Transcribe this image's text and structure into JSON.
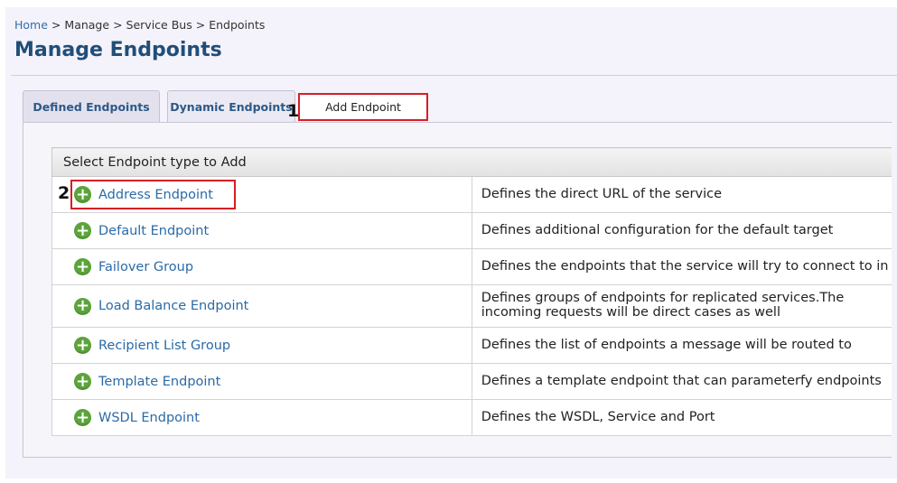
{
  "breadcrumb": {
    "items": [
      "Home",
      "Manage",
      "Service Bus",
      "Endpoints"
    ],
    "separator": ">"
  },
  "page_title": "Manage Endpoints",
  "tabs": {
    "defined": "Defined Endpoints",
    "dynamic": "Dynamic Endpoints",
    "add": "Add Endpoint"
  },
  "callouts": {
    "one": "1",
    "two": "2"
  },
  "table": {
    "header": "Select Endpoint type to Add",
    "rows": [
      {
        "name": "Address Endpoint",
        "icon": "plus-circle-icon",
        "description": "Defines the direct URL of the service"
      },
      {
        "name": "Default Endpoint",
        "icon": "plus-circle-icon",
        "description": "Defines additional configuration for the default target"
      },
      {
        "name": "Failover Group",
        "icon": "plus-circle-icon",
        "description": "Defines the endpoints that the service will try to connect to in case of a failure. This will"
      },
      {
        "name": "Load Balance Endpoint",
        "icon": "plus-circle-icon",
        "description": "Defines groups of endpoints for replicated services.The incoming requests will be direct cases as well"
      },
      {
        "name": "Recipient List Group",
        "icon": "plus-circle-icon",
        "description": "Defines the list of endpoints a message will be routed to"
      },
      {
        "name": "Template Endpoint",
        "icon": "plus-circle-icon",
        "description": "Defines a template endpoint that can parameterfy endpoints"
      },
      {
        "name": "WSDL Endpoint",
        "icon": "plus-circle-icon",
        "description": "Defines the WSDL, Service and Port"
      }
    ]
  },
  "colors": {
    "accent": "#2a6aa7",
    "title": "#1f4e79",
    "highlight": "#d51f26",
    "icon_green": "#5ba43a"
  }
}
